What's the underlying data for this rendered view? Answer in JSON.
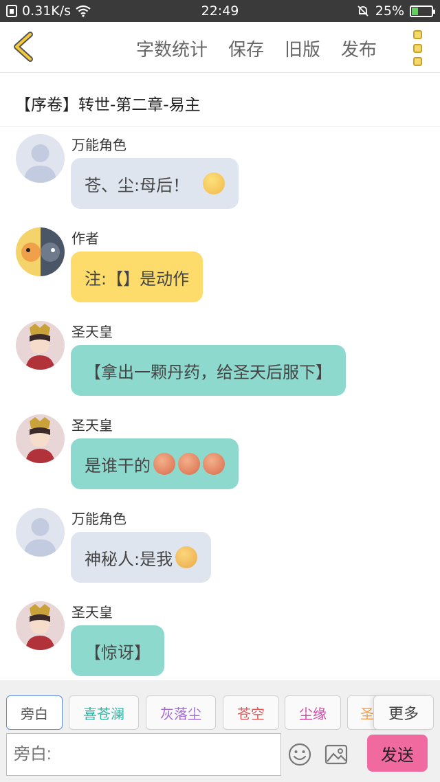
{
  "status_bar": {
    "speed": "0.31K/s",
    "time": "22:49",
    "battery": "25%",
    "battery_level": 0.25
  },
  "toolbar": {
    "word_count": "字数统计",
    "save": "保存",
    "old_version": "旧版",
    "publish": "发布"
  },
  "chapter_title": "【序卷】转世-第二章-易主",
  "messages": [
    {
      "name": "万能角色",
      "text": "苍、尘:母后！",
      "style": "gray",
      "avatar": "default-avatar",
      "emoji": [
        "crying-face"
      ]
    },
    {
      "name": "作者",
      "text": "注:【】是动作",
      "style": "yellow",
      "avatar": "author-avatar",
      "emoji": []
    },
    {
      "name": "圣天皇",
      "text": "【拿出一颗丹药，给圣天后服下】",
      "style": "teal",
      "avatar": "emperor-avatar",
      "emoji": []
    },
    {
      "name": "圣天皇",
      "text": "是谁干的",
      "style": "teal",
      "avatar": "emperor-avatar",
      "emoji": [
        "angry-face",
        "angry-face",
        "angry-face"
      ]
    },
    {
      "name": "万能角色",
      "text": "神秘人:是我",
      "style": "gray",
      "avatar": "default-avatar",
      "emoji": [
        "smirk-face"
      ]
    },
    {
      "name": "圣天皇",
      "text": "【惊讶】",
      "style": "teal",
      "avatar": "emperor-avatar",
      "emoji": []
    }
  ],
  "character_tabs": [
    {
      "label": "旁白",
      "color": "#555555",
      "active": true
    },
    {
      "label": "喜苍澜",
      "color": "#2bb6a6",
      "active": false
    },
    {
      "label": "灰落尘",
      "color": "#a46cd4",
      "active": false
    },
    {
      "label": "苍空",
      "color": "#e05a5a",
      "active": false
    },
    {
      "label": "尘缘",
      "color": "#d44aa8",
      "active": false
    },
    {
      "label": "圣",
      "color": "#f0a04a",
      "active": false
    }
  ],
  "more_label": "更多",
  "input": {
    "placeholder": "旁白:",
    "value": ""
  },
  "send_label": "发送",
  "colors": {
    "bubble_gray": "#dfe5ee",
    "bubble_yellow": "#fddc6c",
    "bubble_teal": "#8ed9ce",
    "send_button": "#f06aa0",
    "back_arrow": "#f5c93a"
  }
}
